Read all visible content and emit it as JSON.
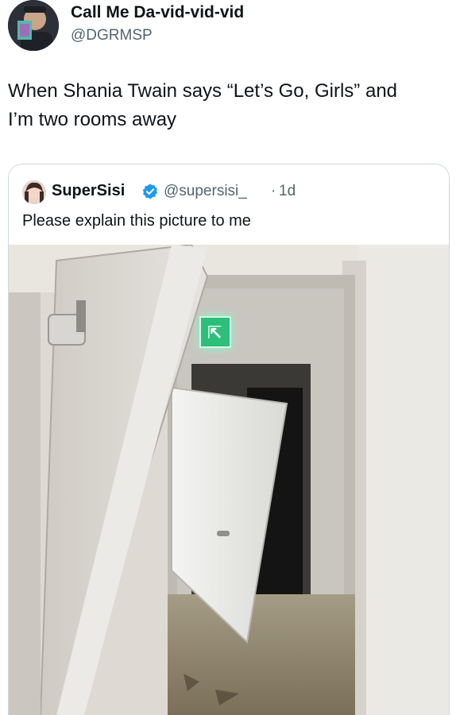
{
  "post": {
    "author": {
      "display_name": "Call Me Da-vid-vid-vid",
      "handle": "@DGRMSP",
      "avatar_icon": "profile-avatar"
    },
    "text_line_1": "When Shania Twain says “Let’s Go, Girls” and",
    "text_line_2": "I’m two rooms away"
  },
  "quote": {
    "display_name": "SuperSisi",
    "handle": "@supersisi_",
    "separator": "·",
    "time": "1d",
    "verified_icon": "verified-badge-icon",
    "text": "Please explain this picture to me"
  },
  "photo": {
    "description_icon": "hallway-broken-doors-photo",
    "exit_sign_icon": "emergency-exit-sign-icon"
  },
  "colors": {
    "text": "#0f1419",
    "secondary_text": "#536471",
    "verified_blue": "#1d9bf0",
    "border": "#cfd9de"
  }
}
